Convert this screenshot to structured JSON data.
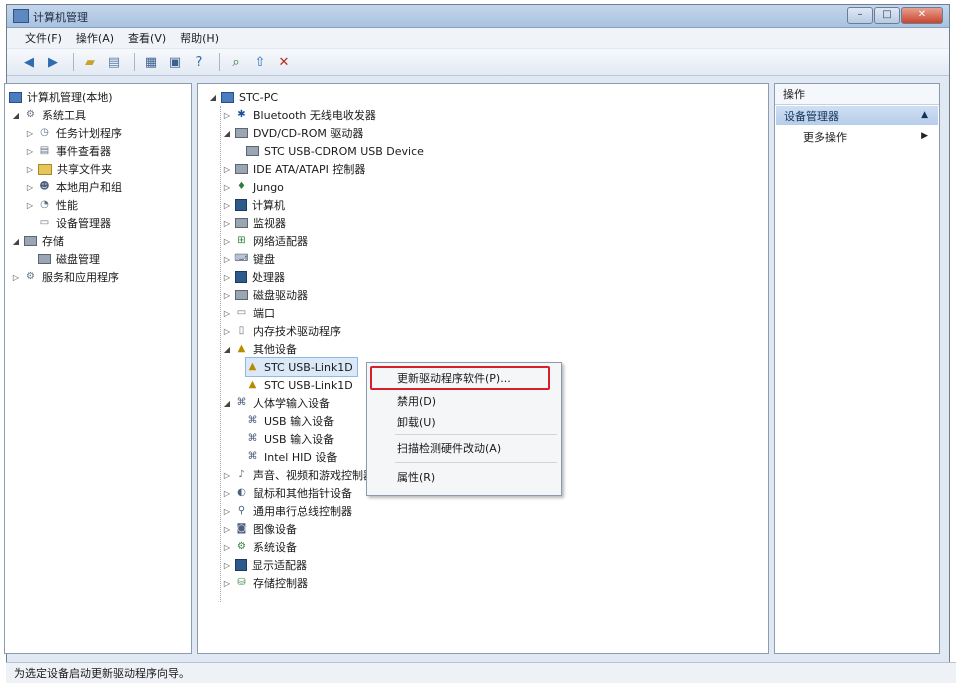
{
  "window": {
    "title": "计算机管理",
    "minimize_label": "–",
    "maximize_label": "□",
    "close_label": "✕"
  },
  "menu": [
    "文件(F)",
    "操作(A)",
    "查看(V)",
    "帮助(H)"
  ],
  "toolbar_icons": [
    "back-arrow-icon",
    "forward-arrow-icon",
    "up-folder-icon",
    "console-tree-icon",
    "properties-icon",
    "refresh-icon",
    "help-icon",
    "scan-hardware-icon",
    "update-driver-icon",
    "uninstall-icon"
  ],
  "left_tree": {
    "root": "计算机管理(本地)",
    "system_tools": "系统工具",
    "task_scheduler": "任务计划程序",
    "event_viewer": "事件查看器",
    "shared_folders": "共享文件夹",
    "local_users": "本地用户和组",
    "performance": "性能",
    "device_manager": "设备管理器",
    "storage": "存储",
    "disk_management": "磁盘管理",
    "services_apps": "服务和应用程序"
  },
  "device_tree": {
    "computer": "STC-PC",
    "bluetooth": "Bluetooth 无线电收发器",
    "dvd": "DVD/CD-ROM 驱动器",
    "dvd_child": "STC USB-CDROM USB Device",
    "ide": "IDE ATA/ATAPI 控制器",
    "jungo": "Jungo",
    "computer_node": "计算机",
    "monitors": "监视器",
    "network": "网络适配器",
    "keyboards": "键盘",
    "processors": "处理器",
    "disks": "磁盘驱动器",
    "ports": "端口",
    "memory": "内存技术驱动程序",
    "other_devices": "其他设备",
    "stc_usb_1": "STC USB-Link1D",
    "stc_usb_2": "STC USB-Link1D",
    "hid": "人体学输入设备",
    "usb_input_1": "USB 输入设备",
    "usb_input_2": "USB 输入设备",
    "hid_composite": "Intel HID 设备",
    "sound": "声音、视频和游戏控制器",
    "mice": "鼠标和其他指针设备",
    "usb_controllers": "通用串行总线控制器",
    "imaging": "图像设备",
    "system_devices": "系统设备",
    "display": "显示适配器",
    "storage_ctrl": "存储控制器",
    "tick": "✓"
  },
  "context_menu": {
    "update_driver": "更新驱动程序软件(P)...",
    "disable": "禁用(D)",
    "uninstall": "卸载(U)",
    "scan": "扫描检测硬件改动(A)",
    "properties": "属性(R)"
  },
  "actions": {
    "header": "操作",
    "section": "设备管理器",
    "more": "更多操作",
    "section_arrow": "▲",
    "more_arrow": "▶"
  },
  "status": "为选定设备启动更新驱动程序向导。",
  "colors": {
    "highlight_box": "#d8202a",
    "selection": "#dbe8f7",
    "titlebar": "#a9c2e0"
  }
}
